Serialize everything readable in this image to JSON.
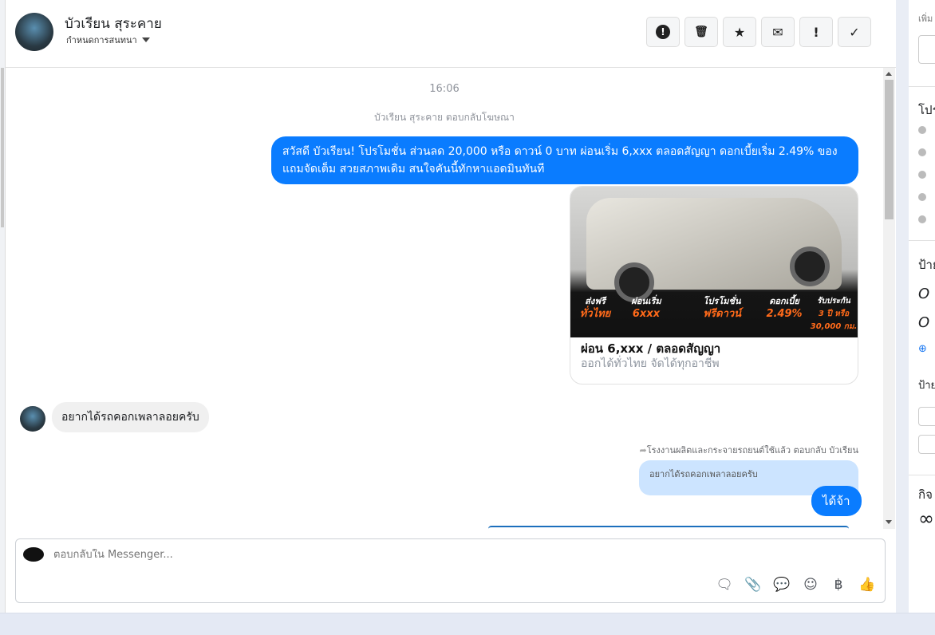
{
  "header": {
    "contact_name": "บัวเรียน สุระคาย",
    "subtitle": "กำหนดการสนทนา",
    "actions": [
      {
        "name": "report-icon",
        "glyph": "!"
      },
      {
        "name": "trash-icon",
        "glyph": "🗑"
      },
      {
        "name": "star-icon",
        "glyph": "★"
      },
      {
        "name": "mail-icon",
        "glyph": "✉"
      },
      {
        "name": "exclamation-icon",
        "glyph": "!"
      },
      {
        "name": "check-icon",
        "glyph": "✓"
      }
    ]
  },
  "conversation": {
    "timestamp": "16:06",
    "reply_note": "บัวเรียน สุระคาย ตอบกลับโฆษณา",
    "promo_message": "สวัสดี บัวเรียน! โปรโมชั่น ส่วนลด 20,000 หรือ ดาวน์ 0 บาท ผ่อนเริ่ม 6,xxx ตลอดสัญญา ดอกเบี้ยเริ่ม 2.49% ของแถมจัดเต็ม สวยสภาพเดิม สนใจคันนี้ทักหาแอดมินทันที",
    "card": {
      "title": "ผ่อน 6,xxx / ตลอดสัญญา",
      "subtitle": "ออกได้ทั่วไทย จัดได้ทุกอาชีพ",
      "promos": [
        {
          "top": "ส่งฟรี",
          "bottom": "ทั่วไทย"
        },
        {
          "top": "ผ่อนเริ่ม",
          "bottom": "6xxx"
        },
        {
          "top": "โปรโมชั่น",
          "bottom": "ฟรีดาวน์"
        },
        {
          "top": "ดอกเบี้ย",
          "bottom": "2.49%"
        },
        {
          "top": "รับประกัน",
          "bottom": "3 ปี หรือ 30,000 กม."
        }
      ]
    },
    "incoming_message": "อยากได้รถคอกเพลาลอยครับ",
    "reply_meta": "โรงงานผลิตและกระจายรถยนต์ใช้แล้ว ตอบกลับ บัวเรียน",
    "quoted_message": "อยากได้รถคอกเพลาลอยครับ",
    "reply_message": "ได้จ้า"
  },
  "composer": {
    "placeholder": "ตอบกลับใน Messenger...",
    "icons": [
      "saved-reply-icon",
      "attachment-icon",
      "chat-icon",
      "emoji-icon",
      "baht-icon",
      "thumbs-up-icon"
    ]
  },
  "right_panel": {
    "add_label": "เพิ่ม",
    "profile_heading": "โปร",
    "labels_heading": "ป้าย",
    "labels_subheading": "ป้าย",
    "activity_heading": "กิจ",
    "infinity": "∞"
  },
  "colors": {
    "accent": "#0a7cff",
    "quoted": "#cce4ff"
  }
}
